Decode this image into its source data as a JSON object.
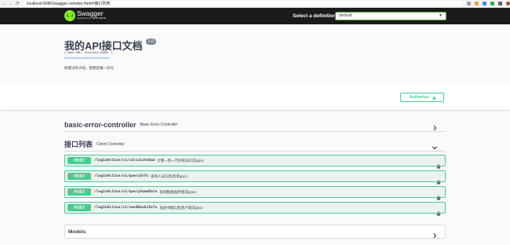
{
  "browser": {
    "back": "←",
    "forward": "→",
    "reload": "⟳",
    "url": "localhost:8080/swagger-ui/index.html#/接口列表"
  },
  "topbar": {
    "logo_letter": "{…}",
    "logo_name": "Swagger",
    "logo_sub": "supported by SMARTBEAR",
    "definition_label": "Select a definition",
    "definition_value": "default",
    "definition_arrow": "▼"
  },
  "info": {
    "title": "我的API接口文档",
    "version": "1.0",
    "base_url": "[ Base URL: localhost:8080/ ]",
    "docs_link": "http://localhost:8080/v2/api-docs",
    "description": "如需没有大呢，我便是唯一的光"
  },
  "authorize": {
    "label": "Authorize"
  },
  "tags": [
    {
      "name": "basic-error-controller",
      "description": "Basic Error Controller"
    },
    {
      "name": "接口列表",
      "description": "Client Controller"
    }
  ],
  "operations": [
    {
      "method": "POST",
      "path": "/loginAction/v1/calculateSum",
      "summary": "计算一到一万的和(双向流grpc)"
    },
    {
      "method": "POST",
      "path": "/loginAction/v1/queryInfo",
      "summary": "查询人员信息(简单grpc)"
    },
    {
      "method": "POST",
      "path": "/loginAction/v1/querySomeData",
      "summary": "查询数据(服务端流grpc)"
    },
    {
      "method": "POST",
      "path": "/loginAction/v1/sendBooksInfo",
      "summary": "发送书籍信息(客户端流grpc)"
    }
  ],
  "models": {
    "title": "Models"
  },
  "colors": {
    "post_green": "#49cc90",
    "topbar_bg": "#1b1b1b",
    "logo_green": "#85ea2d",
    "link_blue": "#4990e2"
  },
  "icons": [
    "back-arrow-icon",
    "forward-arrow-icon",
    "reload-icon",
    "lock-icon",
    "chevron-right-icon",
    "chevron-down-icon"
  ]
}
